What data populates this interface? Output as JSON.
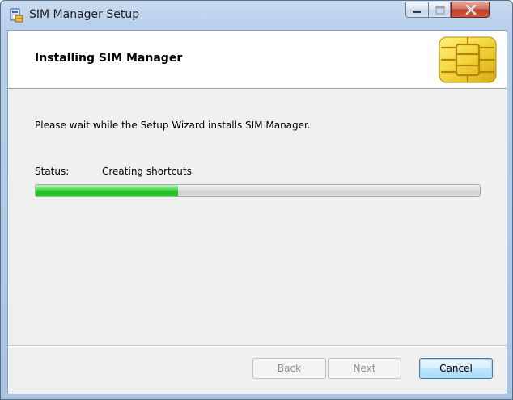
{
  "window": {
    "title": "SIM Manager Setup",
    "controls": {
      "minimize": "minimize",
      "maximize": "maximize",
      "close": "close"
    }
  },
  "banner": {
    "title": "Installing SIM Manager",
    "graphic": "sim-chip-icon"
  },
  "main": {
    "message": "Please wait while the Setup Wizard installs SIM Manager.",
    "status_label": "Status:",
    "status_value": "Creating shortcuts",
    "progress_fraction": 0.32
  },
  "buttons": {
    "back": {
      "mnemonic": "B",
      "rest": "ack",
      "enabled": false
    },
    "next": {
      "mnemonic": "N",
      "rest": "ext",
      "enabled": false
    },
    "cancel": {
      "label": "Cancel",
      "enabled": true
    }
  },
  "colors": {
    "progress_fill": "#31c931",
    "chip_gold": "#f2d53a"
  }
}
